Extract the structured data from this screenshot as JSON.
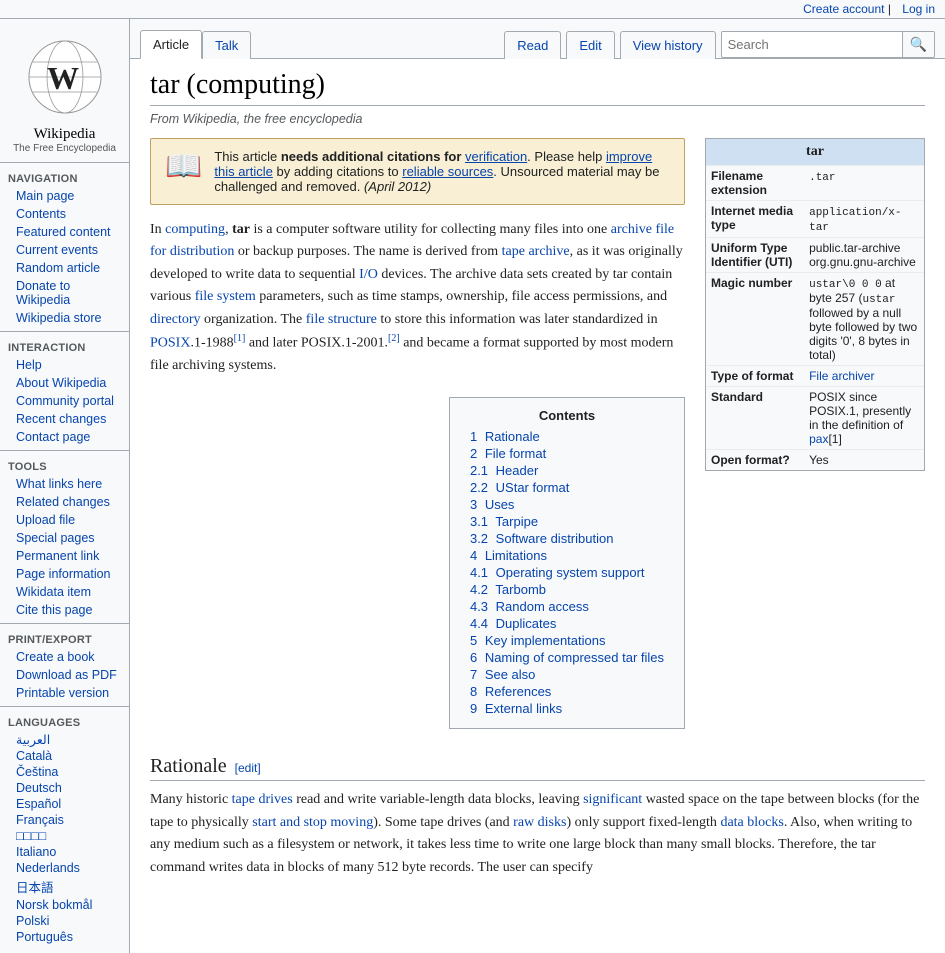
{
  "topbar": {
    "create_account": "Create account",
    "log_in": "Log in"
  },
  "sidebar": {
    "logo_title": "Wikipedia",
    "logo_subtitle": "The Free Encyclopedia",
    "navigation_header": "Navigation",
    "nav_items": [
      {
        "label": "Main page",
        "href": "#"
      },
      {
        "label": "Contents",
        "href": "#"
      },
      {
        "label": "Featured content",
        "href": "#"
      },
      {
        "label": "Current events",
        "href": "#"
      },
      {
        "label": "Random article",
        "href": "#"
      },
      {
        "label": "Donate to Wikipedia",
        "href": "#"
      },
      {
        "label": "Wikipedia store",
        "href": "#"
      }
    ],
    "interaction_header": "Interaction",
    "interaction_items": [
      {
        "label": "Help",
        "href": "#"
      },
      {
        "label": "About Wikipedia",
        "href": "#"
      },
      {
        "label": "Community portal",
        "href": "#"
      },
      {
        "label": "Recent changes",
        "href": "#"
      },
      {
        "label": "Contact page",
        "href": "#"
      }
    ],
    "tools_header": "Tools",
    "tools_items": [
      {
        "label": "What links here",
        "href": "#"
      },
      {
        "label": "Related changes",
        "href": "#"
      },
      {
        "label": "Upload file",
        "href": "#"
      },
      {
        "label": "Special pages",
        "href": "#"
      },
      {
        "label": "Permanent link",
        "href": "#"
      },
      {
        "label": "Page information",
        "href": "#"
      },
      {
        "label": "Wikidata item",
        "href": "#"
      },
      {
        "label": "Cite this page",
        "href": "#"
      }
    ],
    "print_header": "Print/export",
    "print_items": [
      {
        "label": "Create a book",
        "href": "#"
      },
      {
        "label": "Download as PDF",
        "href": "#"
      },
      {
        "label": "Printable version",
        "href": "#"
      }
    ],
    "languages_header": "Languages",
    "language_items": [
      {
        "label": "العربية",
        "href": "#"
      },
      {
        "label": "Català",
        "href": "#"
      },
      {
        "label": "Čeština",
        "href": "#"
      },
      {
        "label": "Deutsch",
        "href": "#"
      },
      {
        "label": "Español",
        "href": "#"
      },
      {
        "label": "Français",
        "href": "#"
      },
      {
        "label": "日本語",
        "href": "#"
      },
      {
        "label": "Italiano",
        "href": "#"
      },
      {
        "label": "Nederlands",
        "href": "#"
      },
      {
        "label": "日本語",
        "href": "#"
      },
      {
        "label": "Norsk bokmål",
        "href": "#"
      },
      {
        "label": "Polski",
        "href": "#"
      },
      {
        "label": "Português",
        "href": "#"
      }
    ]
  },
  "tabs": {
    "article": "Article",
    "talk": "Talk",
    "read": "Read",
    "edit": "Edit",
    "view_history": "View history"
  },
  "search": {
    "placeholder": "Search"
  },
  "article": {
    "title": "tar (computing)",
    "subtitle": "From Wikipedia, the free encyclopedia",
    "citation_notice": {
      "text_before": "This article ",
      "bold_text": "needs additional citations for",
      "link_text": "verification",
      "text_after": ". Please help ",
      "improve_link": "improve this article",
      "text2": " by adding citations to ",
      "reliable_sources_link": "reliable sources",
      "text3": ". Unsourced material may be challenged and removed.",
      "date": "(April 2012)"
    },
    "intro": "In computing, tar is a computer software utility for collecting many files into one archive file for distribution or backup purposes. The name is derived from tape archive, as it was originally developed to write data to sequential I/O devices. The archive data sets created by tar contain various file system parameters, such as time stamps, ownership, file access permissions, and directory organization. The file structure to store this information was later standardized in POSIX.1-1988[1] and later POSIX.1-2001.[2] and became a format supported by most modern file archiving systems.",
    "infobox": {
      "title": "tar",
      "rows": [
        {
          "label": "Filename extension",
          "value": ".tar"
        },
        {
          "label": "Internet media type",
          "value": "application/x-tar"
        },
        {
          "label": "Uniform Type Identifier (UTI)",
          "value": "public.tar-archive org.gnu.gnu-archive"
        },
        {
          "label": "Magic number",
          "value": "ustar\\0 0 0 at byte 257 (ustar followed by a null byte followed by two digits '0', 8 bytes in total)"
        },
        {
          "label": "Type of format",
          "value": "File archiver",
          "is_link": true
        },
        {
          "label": "Standard",
          "value": "POSIX since POSIX.1, presently in the definition of pax[1]"
        },
        {
          "label": "Open format?",
          "value": "Yes"
        }
      ]
    },
    "toc": {
      "title": "Contents",
      "items": [
        {
          "num": "1",
          "label": "Rationale",
          "sub": []
        },
        {
          "num": "2",
          "label": "File format",
          "sub": [
            {
              "num": "2.1",
              "label": "Header"
            },
            {
              "num": "2.2",
              "label": "UStar format"
            }
          ]
        },
        {
          "num": "3",
          "label": "Uses",
          "sub": [
            {
              "num": "3.1",
              "label": "Tarpipe"
            },
            {
              "num": "3.2",
              "label": "Software distribution"
            }
          ]
        },
        {
          "num": "4",
          "label": "Limitations",
          "sub": [
            {
              "num": "4.1",
              "label": "Operating system support"
            },
            {
              "num": "4.2",
              "label": "Tarbomb"
            },
            {
              "num": "4.3",
              "label": "Random access"
            },
            {
              "num": "4.4",
              "label": "Duplicates"
            }
          ]
        },
        {
          "num": "5",
          "label": "Key implementations",
          "sub": []
        },
        {
          "num": "6",
          "label": "Naming of compressed tar files",
          "sub": []
        },
        {
          "num": "7",
          "label": "See also",
          "sub": []
        },
        {
          "num": "8",
          "label": "References",
          "sub": []
        },
        {
          "num": "9",
          "label": "External links",
          "sub": []
        }
      ]
    },
    "rationale_section": {
      "heading": "Rationale",
      "edit_label": "[edit]",
      "text": "Many historic tape drives read and write variable-length data blocks, leaving significant wasted space on the tape between blocks (for the tape to physically start and stop moving). Some tape drives (and raw disks) only support fixed-length data blocks. Also, when writing to any medium such as a filesystem or network, it takes less time to write one large block than many small blocks. Therefore, the tar command writes data in blocks of many 512 byte records. The user can specify"
    }
  }
}
